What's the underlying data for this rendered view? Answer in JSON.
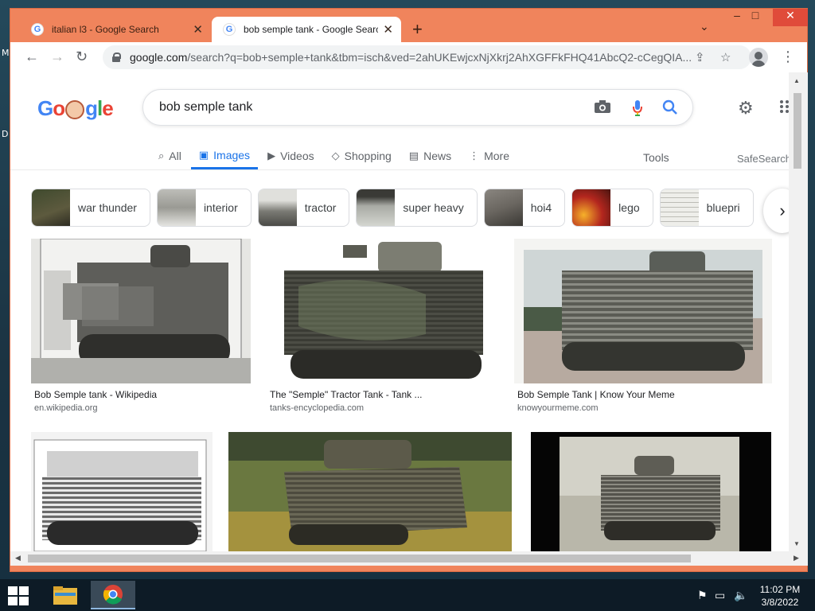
{
  "desktop": {
    "left_letters": [
      "M",
      "D"
    ]
  },
  "browser": {
    "tabs": [
      {
        "title": "italian l3 - Google Search",
        "favicon": "G",
        "active": false
      },
      {
        "title": "bob semple tank - Google Search",
        "favicon": "G",
        "active": true
      }
    ],
    "new_tab_icon": "+",
    "tab_search_icon": "⌄",
    "window_controls": {
      "minimize": "‒",
      "maximize": "□",
      "close": "✕"
    },
    "url_host": "google.com",
    "url_path": "/search?q=bob+semple+tank&tbm=isch&ved=2ahUKEwjcxNjXkrj2AhXGFFkFHQ41AbcQ2-cCegQIA..."
  },
  "google": {
    "logo_letters": [
      {
        "ch": "G",
        "color": "#4285f4"
      },
      {
        "ch": "o",
        "color": "#ea4335"
      },
      {
        "ch": "g",
        "color": "#4285f4"
      },
      {
        "ch": "l",
        "color": "#34a853"
      },
      {
        "ch": "e",
        "color": "#ea4335"
      }
    ],
    "query": "bob semple tank",
    "nav": [
      {
        "label": "All",
        "icon": "⌕",
        "active": false
      },
      {
        "label": "Images",
        "icon": "▣",
        "active": true
      },
      {
        "label": "Videos",
        "icon": "▶",
        "active": false
      },
      {
        "label": "Shopping",
        "icon": "◇",
        "active": false
      },
      {
        "label": "News",
        "icon": "▤",
        "active": false
      },
      {
        "label": "More",
        "icon": "⋮",
        "active": false
      }
    ],
    "tools": "Tools",
    "safesearch": "SafeSearch",
    "chips": [
      {
        "label": "war thunder",
        "thumb_color": "#5d5a3e"
      },
      {
        "label": "interior",
        "thumb_color": "#9a9a94"
      },
      {
        "label": "tractor",
        "thumb_color": "#7a7a74"
      },
      {
        "label": "super heavy",
        "thumb_color": "#a8aaa4"
      },
      {
        "label": "hoi4",
        "thumb_color": "#6a6660"
      },
      {
        "label": "lego",
        "thumb_color": "#b3261e"
      },
      {
        "label": "bluepri",
        "thumb_color": "#d9d9d6"
      }
    ],
    "results": [
      {
        "caption": "Bob Semple tank - Wikipedia",
        "source": "en.wikipedia.org"
      },
      {
        "caption": "The \"Semple\" Tractor Tank - Tank ...",
        "source": "tanks-encyclopedia.com"
      },
      {
        "caption": "Bob Semple Tank | Know Your Meme",
        "source": "knowyourmeme.com"
      },
      {
        "caption": "",
        "source": ""
      },
      {
        "caption": "",
        "source": ""
      },
      {
        "caption": "",
        "source": ""
      }
    ]
  },
  "taskbar": {
    "time": "11:02 PM",
    "date": "3/8/2022"
  },
  "colors": {
    "frame": "#f0845c",
    "google_blue": "#1a73e8"
  }
}
